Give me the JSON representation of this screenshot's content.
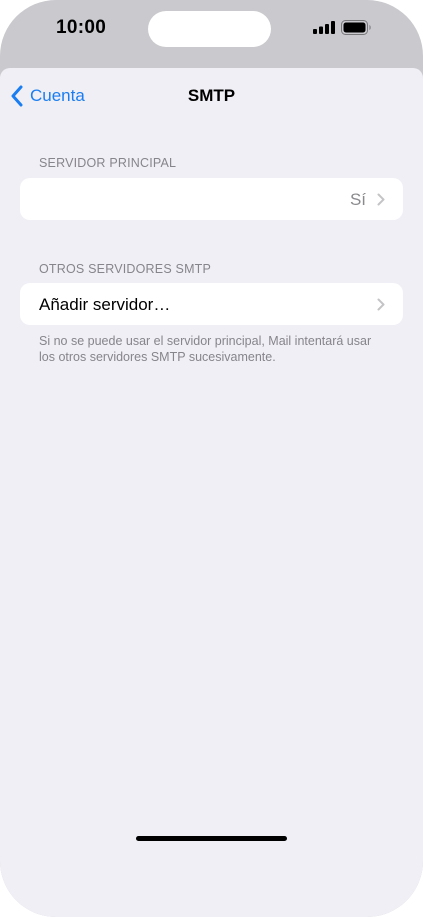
{
  "status_bar": {
    "time": "10:00",
    "signal_icon": "cellular-signal-icon",
    "battery_icon": "battery-full-icon"
  },
  "nav": {
    "back_label": "Cuenta",
    "back_icon": "chevron-left-icon",
    "title": "SMTP"
  },
  "primary_server": {
    "header": "SERVIDOR PRINCIPAL",
    "value": "Sí",
    "disclosure_icon": "chevron-right-icon"
  },
  "other_servers": {
    "header": "OTROS SERVIDORES SMTP",
    "add_label": "Añadir servidor…",
    "disclosure_icon": "chevron-right-icon",
    "footer": "Si no se puede usar el servidor principal, Mail intentará usar los otros servidores SMTP sucesivamente."
  },
  "colors": {
    "accent": "#1a7ef2",
    "background": "#f0eff5",
    "secondary_text": "#86858b"
  }
}
